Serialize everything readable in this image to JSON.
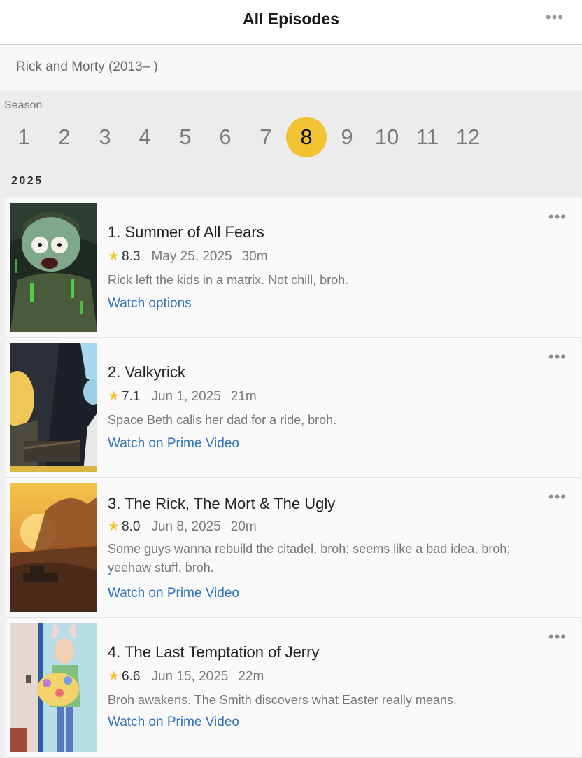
{
  "header": {
    "title": "All Episodes",
    "more": "•••"
  },
  "show": {
    "title": "Rick and Morty (2013– )"
  },
  "season_picker": {
    "label": "Season",
    "seasons": [
      "1",
      "2",
      "3",
      "4",
      "5",
      "6",
      "7",
      "8",
      "9",
      "10",
      "11",
      "12"
    ],
    "selected": "8"
  },
  "year": "2025",
  "episodes": [
    {
      "title": "1. Summer of All Fears",
      "rating": "8.3",
      "date": "May 25, 2025",
      "duration": "30m",
      "description": "Rick left the kids in a matrix. Not chill, broh.",
      "link": "Watch options",
      "more": "•••"
    },
    {
      "title": "2. Valkyrick",
      "rating": "7.1",
      "date": "Jun 1, 2025",
      "duration": "21m",
      "description": "Space Beth calls her dad for a ride, broh.",
      "link": "Watch on Prime Video",
      "more": "•••"
    },
    {
      "title": "3. The Rick, The Mort & The Ugly",
      "rating": "8.0",
      "date": "Jun 8, 2025",
      "duration": "20m",
      "description": "Some guys wanna rebuild the citadel, broh; seems like a bad idea, broh; yeehaw stuff, broh.",
      "link": "Watch on Prime Video",
      "more": "•••"
    },
    {
      "title": "4. The Last Temptation of Jerry",
      "rating": "6.6",
      "date": "Jun 15, 2025",
      "duration": "22m",
      "description": "Broh awakens. The Smith discovers what Easter really means.",
      "link": "Watch on Prime Video",
      "more": "•••"
    }
  ],
  "icons": {
    "star": "★",
    "more": "ellipsis-icon"
  },
  "colors": {
    "accent": "#f1c232",
    "link": "#2f72b7"
  }
}
